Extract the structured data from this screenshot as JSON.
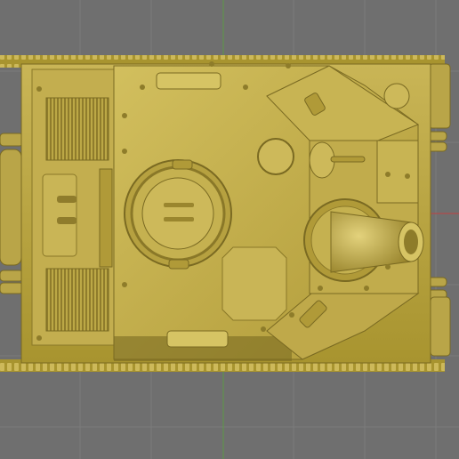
{
  "viewport": {
    "background": "#6f6f6f",
    "grid_color": "#7b7b7b",
    "axis_x_color": "#c04040",
    "axis_y_color": "#5c9a45"
  },
  "model": {
    "name_icon": "tank-top-view",
    "base_color": "#b9a548",
    "light_color": "#d8c86a",
    "shadow_color": "#7a6a22"
  }
}
